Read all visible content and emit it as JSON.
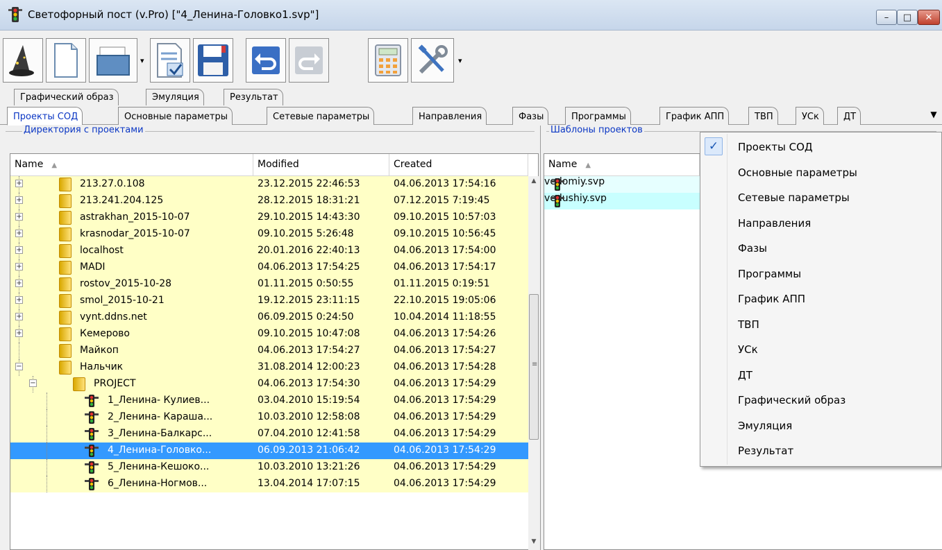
{
  "window": {
    "title": "Светофорный пост (v.Pro) [\"4_Ленина-Головко1.svp\"]",
    "controls": {
      "minimize": "–",
      "maximize": "□",
      "close": "✕"
    }
  },
  "toolbar": {
    "buttons": [
      "wizard-icon",
      "new-file-icon",
      "open-folder-icon",
      "check-document-icon",
      "save-icon",
      "undo-icon",
      "redo-icon",
      "calculator-icon",
      "tools-icon"
    ],
    "dropdown_glyph": "▾"
  },
  "tabs_top": [
    "Графический образ",
    "Эмуляция",
    "Результат"
  ],
  "tabs_sub": [
    "Проекты СОД",
    "Основные параметры",
    "Сетевые параметры",
    "Направления",
    "Фазы",
    "Программы",
    "График АПП",
    "ТВП",
    "УСк",
    "ДТ"
  ],
  "tabs_dropdown": "▼",
  "left_panel": {
    "group_label": "Директория с проектами",
    "columns": {
      "name": "Name",
      "sort": "▲",
      "modified": "Modified",
      "created": "Created"
    },
    "rows": [
      {
        "name": "213.27.0.108",
        "modified": "23.12.2015 22:46:53",
        "created": "04.06.2013 17:54:16"
      },
      {
        "name": "213.241.204.125",
        "modified": "28.12.2015 18:31:21",
        "created": "07.12.2015 7:19:45"
      },
      {
        "name": "astrakhan_2015-10-07",
        "modified": "29.10.2015 14:43:30",
        "created": "09.10.2015 10:57:03"
      },
      {
        "name": "krasnodar_2015-10-07",
        "modified": "09.10.2015 5:26:48",
        "created": "09.10.2015 10:56:45"
      },
      {
        "name": "localhost",
        "modified": "20.01.2016 22:40:13",
        "created": "04.06.2013 17:54:00"
      },
      {
        "name": "MADI",
        "modified": "04.06.2013 17:54:25",
        "created": "04.06.2013 17:54:17"
      },
      {
        "name": "rostov_2015-10-28",
        "modified": "01.11.2015 0:50:55",
        "created": "01.11.2015 0:19:51"
      },
      {
        "name": "smol_2015-10-21",
        "modified": "19.12.2015 23:11:15",
        "created": "22.10.2015 19:05:06"
      },
      {
        "name": "vynt.ddns.net",
        "modified": "06.09.2015 0:24:50",
        "created": "10.04.2014 11:18:55"
      },
      {
        "name": "Кемерово",
        "modified": "09.10.2015 10:47:08",
        "created": "04.06.2013 17:54:26"
      },
      {
        "name": "Майкоп",
        "modified": "04.06.2013 17:54:27",
        "created": "04.06.2013 17:54:27"
      },
      {
        "name": "Нальчик",
        "modified": "31.08.2014 12:00:23",
        "created": "04.06.2013 17:54:28"
      },
      {
        "name": "PROJECT",
        "modified": "04.06.2013 17:54:30",
        "created": "04.06.2013 17:54:29"
      },
      {
        "name": "1_Ленина- Кулиев...",
        "modified": "03.04.2010 15:19:54",
        "created": "04.06.2013 17:54:29"
      },
      {
        "name": "2_Ленина- Караша...",
        "modified": "10.03.2010 12:58:08",
        "created": "04.06.2013 17:54:29"
      },
      {
        "name": "3_Ленина-Балкарс...",
        "modified": "07.04.2010 12:41:58",
        "created": "04.06.2013 17:54:29"
      },
      {
        "name": "4_Ленина-Головко...",
        "modified": "06.09.2013 21:06:42",
        "created": "04.06.2013 17:54:29"
      },
      {
        "name": "5_Ленина-Кешоко...",
        "modified": "10.03.2010 13:21:26",
        "created": "04.06.2013 17:54:29"
      },
      {
        "name": "6_Ленина-Ногмов...",
        "modified": "13.04.2014 17:07:15",
        "created": "04.06.2013 17:54:29"
      }
    ],
    "scrollbar": {
      "up": "▲",
      "down": "▼",
      "grip": "≡"
    }
  },
  "right_panel": {
    "group_label": "Шаблоны проектов",
    "columns": {
      "name": "Name",
      "sort": "▲"
    },
    "rows": [
      {
        "name": "vedomiy.svp"
      },
      {
        "name": "vedushiy.svp"
      }
    ]
  },
  "context_menu": {
    "check": "✓",
    "items": [
      "Проекты СОД",
      "Основные параметры",
      "Сетевые параметры",
      "Направления",
      "Фазы",
      "Программы",
      "График АПП",
      "ТВП",
      "УСк",
      "ДТ",
      "Графический образ",
      "Эмуляция",
      "Результат"
    ],
    "checked_index": 0
  }
}
